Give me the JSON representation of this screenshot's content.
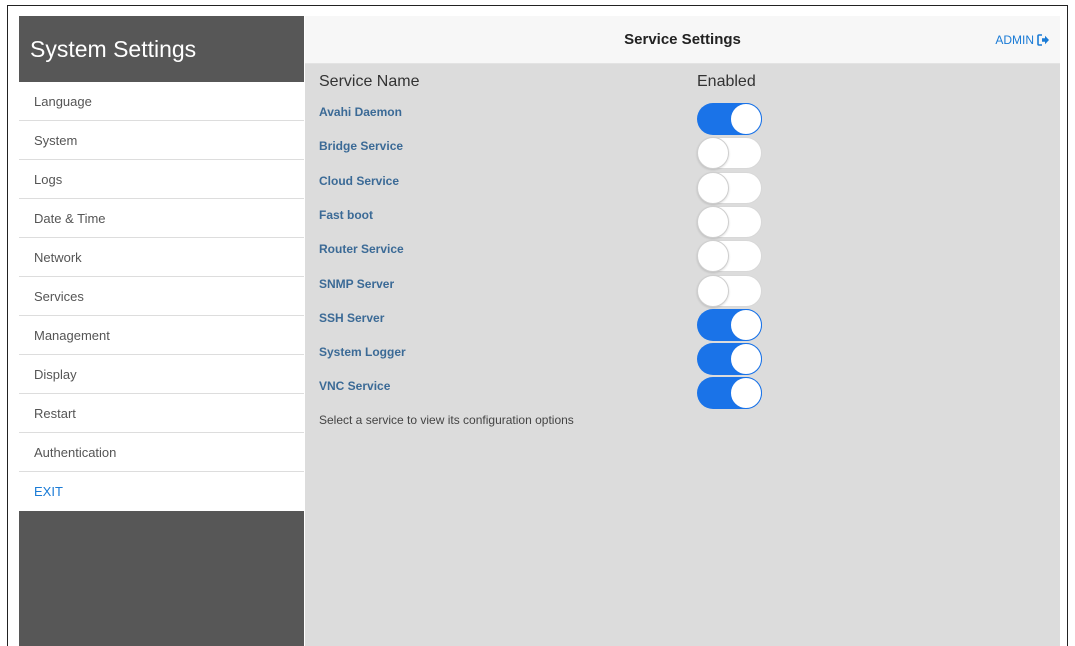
{
  "sidebar": {
    "title": "System Settings",
    "items": [
      {
        "label": "Language",
        "name": "sidebar-item-language"
      },
      {
        "label": "System",
        "name": "sidebar-item-system"
      },
      {
        "label": "Logs",
        "name": "sidebar-item-logs"
      },
      {
        "label": "Date & Time",
        "name": "sidebar-item-date-time"
      },
      {
        "label": "Network",
        "name": "sidebar-item-network"
      },
      {
        "label": "Services",
        "name": "sidebar-item-services"
      },
      {
        "label": "Management",
        "name": "sidebar-item-management"
      },
      {
        "label": "Display",
        "name": "sidebar-item-display"
      },
      {
        "label": "Restart",
        "name": "sidebar-item-restart"
      },
      {
        "label": "Authentication",
        "name": "sidebar-item-authentication"
      },
      {
        "label": "EXIT",
        "name": "sidebar-item-exit"
      }
    ]
  },
  "header": {
    "title": "Service Settings",
    "user_label": "ADMIN",
    "user_icon": "logout-icon"
  },
  "table": {
    "col_name": "Service Name",
    "col_enabled": "Enabled"
  },
  "services": [
    {
      "name": "Avahi Daemon",
      "enabled": true
    },
    {
      "name": "Bridge Service",
      "enabled": false
    },
    {
      "name": "Cloud Service",
      "enabled": false
    },
    {
      "name": "Fast boot",
      "enabled": false
    },
    {
      "name": "Router Service",
      "enabled": false
    },
    {
      "name": "SNMP Server",
      "enabled": false
    },
    {
      "name": "SSH Server",
      "enabled": true
    },
    {
      "name": "System Logger",
      "enabled": true
    },
    {
      "name": "VNC Service",
      "enabled": true
    }
  ],
  "hint": "Select a service to view its configuration options",
  "colors": {
    "accent": "#1a73e8",
    "link": "#1a7bd6",
    "sidebar_bg": "#575757",
    "main_bg": "#dcdcdc"
  }
}
